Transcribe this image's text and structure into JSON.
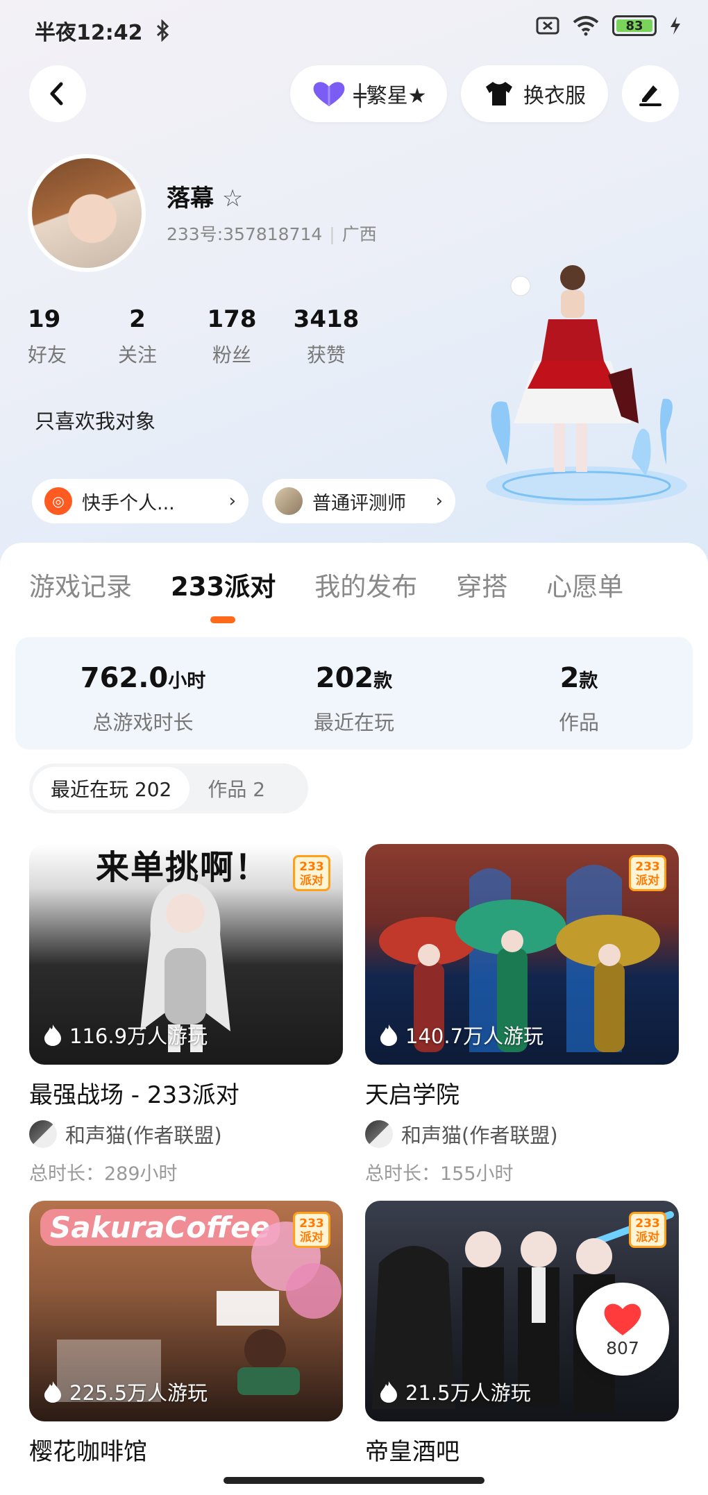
{
  "status_bar": {
    "time": "半夜12:42",
    "battery": "83"
  },
  "header": {
    "star_button": "╪繁星★",
    "outfit_button": "换衣服"
  },
  "profile": {
    "name": "落幕",
    "name_suffix": "☆",
    "uid": "233号:357818714",
    "region": "广西",
    "stats": [
      {
        "value": "19",
        "label": "好友"
      },
      {
        "value": "2",
        "label": "关注"
      },
      {
        "value": "178",
        "label": "粉丝"
      },
      {
        "value": "3418",
        "label": "获赞"
      }
    ],
    "bio": "只喜欢我对象",
    "chips": [
      {
        "label": "快手个人..."
      },
      {
        "label": "普通评测师"
      }
    ]
  },
  "tabs": [
    "游戏记录",
    "233派对",
    "我的发布",
    "穿搭",
    "心愿单"
  ],
  "summary": [
    {
      "value": "762.0",
      "unit": "小时",
      "label": "总游戏时长"
    },
    {
      "value": "202",
      "unit": "款",
      "label": "最近在玩"
    },
    {
      "value": "2",
      "unit": "款",
      "label": "作品"
    }
  ],
  "segment": {
    "recent": "最近在玩 202",
    "works": "作品 2"
  },
  "badge": {
    "line1": "233",
    "line2": "派对"
  },
  "games": [
    {
      "title": "最强战场 - 233派对",
      "plays": "116.9万人游玩",
      "author": "和声猫(作者联盟)",
      "duration": "总时长：289小时",
      "overlay_text": "来单挑啊！"
    },
    {
      "title": "天启学院",
      "plays": "140.7万人游玩",
      "author": "和声猫(作者联盟)",
      "duration": "总时长：155小时"
    },
    {
      "title": "樱花咖啡馆",
      "plays": "225.5万人游玩",
      "overlay_text": "SakuraCoffee"
    },
    {
      "title": "帝皇酒吧",
      "plays": "21.5万人游玩"
    }
  ],
  "like_count": "807",
  "colors": {
    "accent": "#ff6a1a",
    "card_bg": "#f1f6fd",
    "badge_orange": "#ff9f1a"
  }
}
